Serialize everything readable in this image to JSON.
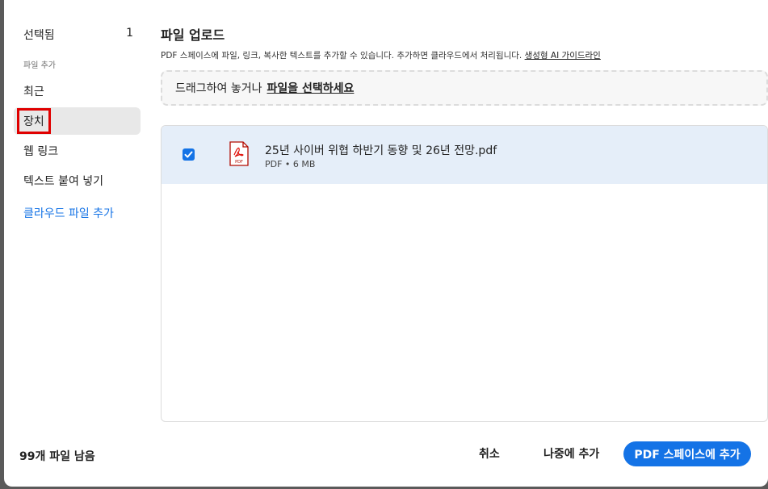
{
  "sidebar": {
    "selected_label": "선택됨",
    "selected_count": "1",
    "section_label": "파일 추가",
    "items": [
      {
        "label": "최근"
      },
      {
        "label": "장치"
      },
      {
        "label": "웹 링크"
      },
      {
        "label": "텍스트 붙여 넣기"
      },
      {
        "label": "클라우드 파일 추가"
      }
    ],
    "remaining": "99개 파일 남음"
  },
  "main": {
    "title": "파일 업로드",
    "description": "PDF 스페이스에 파일, 링크, 복사한 텍스트를 추가할 수 있습니다. 추가하면 클라우드에서 처리됩니다.",
    "guideline_link": "생성형 AI 가이드라인",
    "dropzone_text": "드래그하여 놓거나",
    "dropzone_link": "파일을 선택하세요",
    "files": [
      {
        "name": "25년 사이버 위협 하반기 동향 및 26년 전망.pdf",
        "meta": "PDF • 6 MB",
        "checked": true,
        "icon": "pdf-file-icon"
      }
    ]
  },
  "footer": {
    "cancel": "취소",
    "later": "나중에 추가",
    "primary": "PDF 스페이스에 추가"
  },
  "colors": {
    "accent": "#1473e6",
    "selected_row_bg": "#e5eef9",
    "highlight_box": "#e00000"
  }
}
